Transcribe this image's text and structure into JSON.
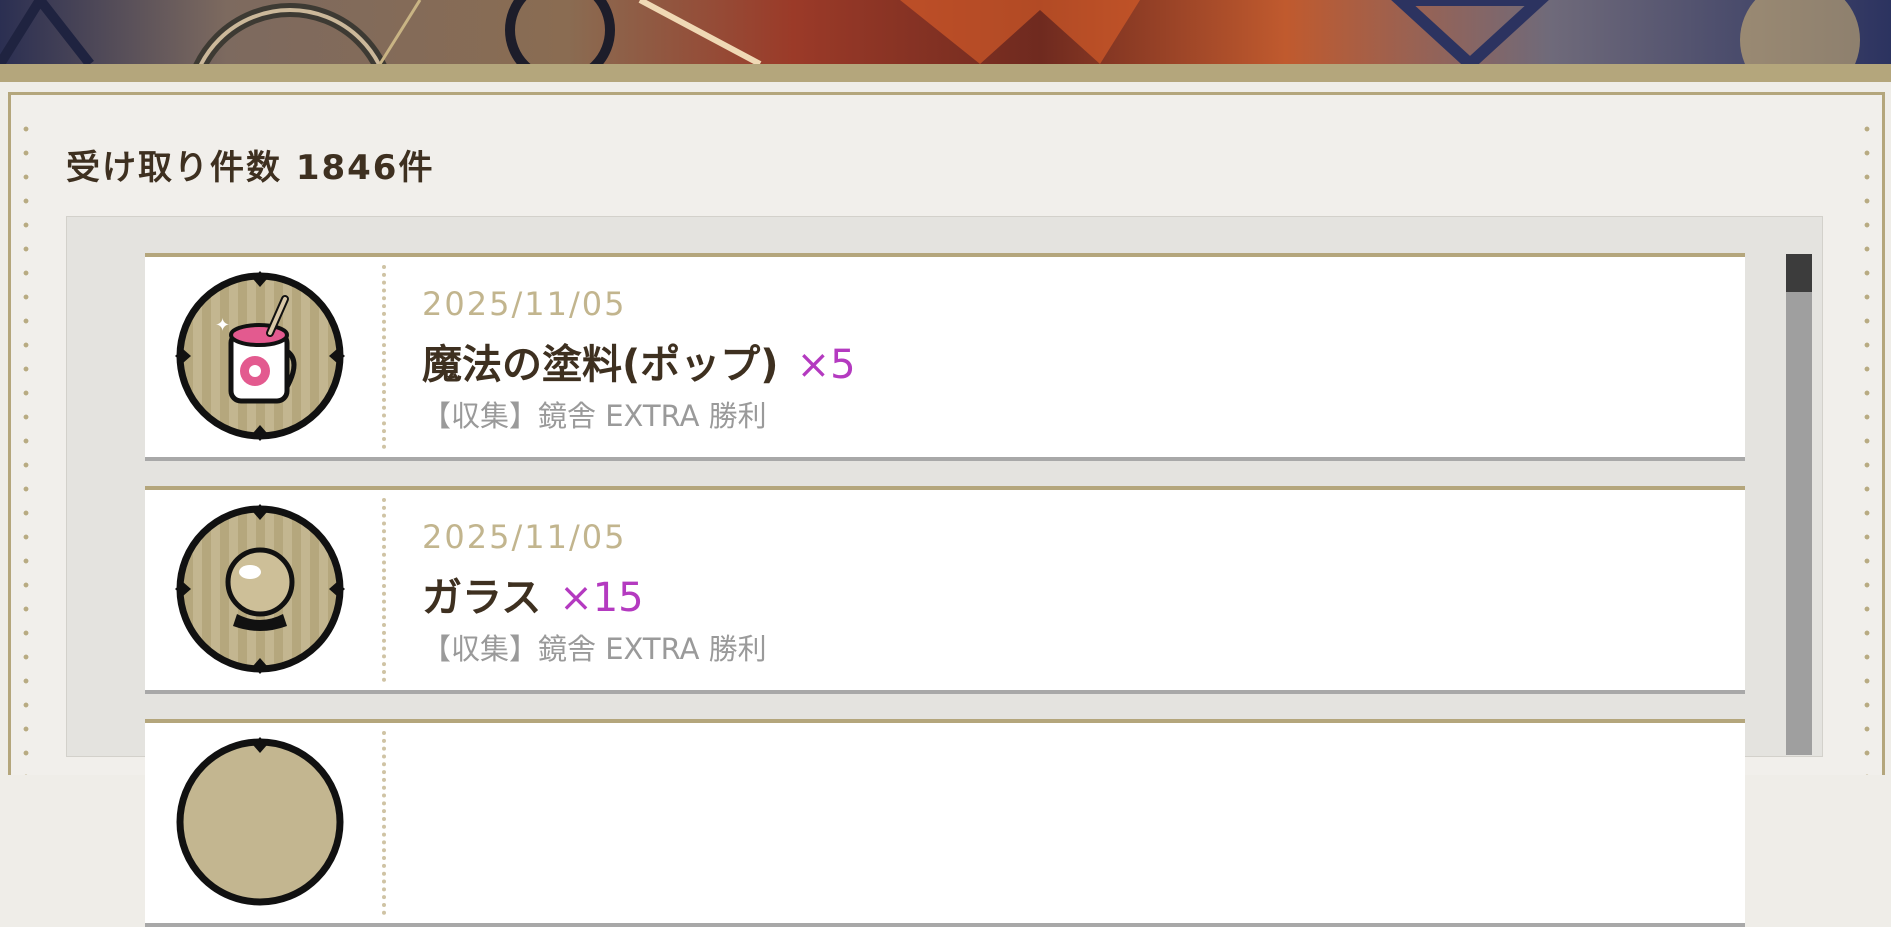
{
  "header": {
    "count_label": "受け取り件数 1846件"
  },
  "items": [
    {
      "date": "2025/11/05",
      "name": "魔法の塗料(ポップ)",
      "qty": "×5",
      "source": "【収集】鏡舎 EXTRA 勝利",
      "icon": "paint-jar-icon"
    },
    {
      "date": "2025/11/05",
      "name": "ガラス",
      "qty": "×15",
      "source": "【収集】鏡舎 EXTRA 勝利",
      "icon": "glass-orb-icon"
    }
  ],
  "colors": {
    "accent_gold": "#b4a67c",
    "quantity_purple": "#b43ac0",
    "text_dark": "#3e3020",
    "date_gold": "#c2b58e"
  }
}
